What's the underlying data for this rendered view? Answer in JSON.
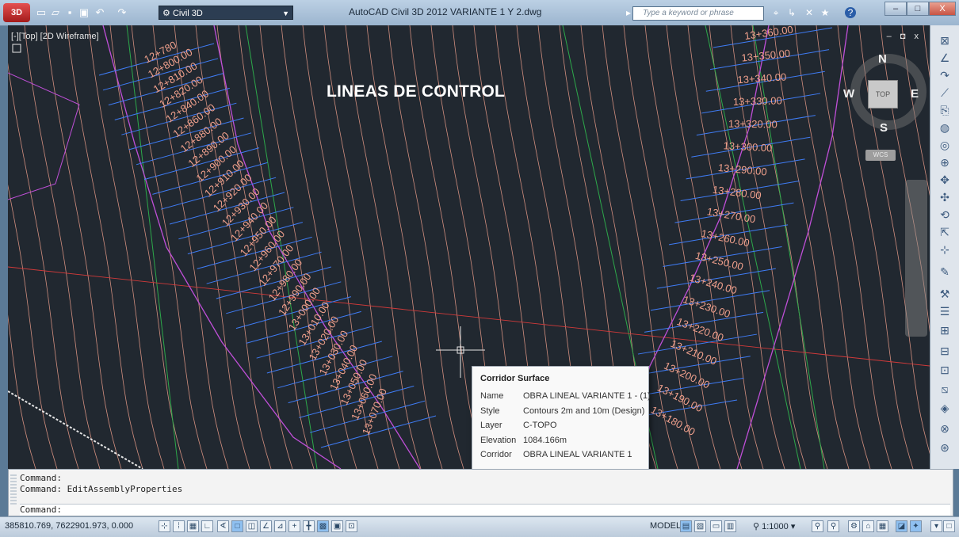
{
  "titlebar": {
    "workspace": "Civil 3D",
    "title": "AutoCAD Civil 3D 2012    VARIANTE 1 Y 2.dwg",
    "search_placeholder": "Type a keyword or phrase"
  },
  "viewport": {
    "label": "[-][Top] [2D Wireframe]",
    "annotation": "LINEAS DE CONTROL",
    "viewcube": {
      "top": "TOP",
      "north": "N",
      "south": "S",
      "east": "E",
      "west": "W",
      "wcs": "WCS"
    }
  },
  "stations_left": [
    "12+780",
    "12+800.00",
    "12+810.00",
    "12+820.00",
    "12+840.00",
    "12+860.00",
    "12+880.00",
    "12+890.00",
    "12+900.00",
    "12+910.00",
    "12+920.00",
    "12+930.00",
    "12+940.00",
    "12+950.00",
    "12+960.00",
    "12+970.00",
    "12+980.00",
    "12+990.00",
    "13+000.00",
    "13+010.00",
    "13+020.00",
    "13+030.00",
    "13+040.00",
    "13+050.00",
    "13+060.00",
    "13+070.00"
  ],
  "stations_right": [
    "13+360.00",
    "13+350.00",
    "13+340.00",
    "13+330.00",
    "13+320.00",
    "13+300.00",
    "13+290.00",
    "13+280.00",
    "13+270.00",
    "13+260.00",
    "13+250.00",
    "13+240.00",
    "13+230.00",
    "13+220.00",
    "13+210.00",
    "13+200.00",
    "13+190.00",
    "13+180.00"
  ],
  "tooltip": {
    "title": "Corridor Surface",
    "rows": [
      {
        "label": "Name",
        "value": "OBRA LINEAL VARIANTE 1 - (1)"
      },
      {
        "label": "Style",
        "value": "Contours 2m and 10m (Design)"
      },
      {
        "label": "Layer",
        "value": "C-TOPO"
      },
      {
        "label": "Elevation",
        "value": "1084.166m"
      },
      {
        "label": "Corridor",
        "value": "OBRA LINEAL VARIANTE 1"
      }
    ]
  },
  "command": {
    "history": [
      "Command:",
      "Command: EditAssemblyProperties"
    ],
    "prompt": "Command:"
  },
  "status": {
    "coordinates": "385810.769, 7622901.973, 0.000",
    "model": "MODEL",
    "scale": "1:1000"
  },
  "colors": {
    "viewport_bg": "#212830",
    "contour": "#f0a08c",
    "station_blue": "#3f7cf5",
    "alignment_magenta": "#c04fd8",
    "green": "#2da84a",
    "red": "#d23a3a"
  }
}
